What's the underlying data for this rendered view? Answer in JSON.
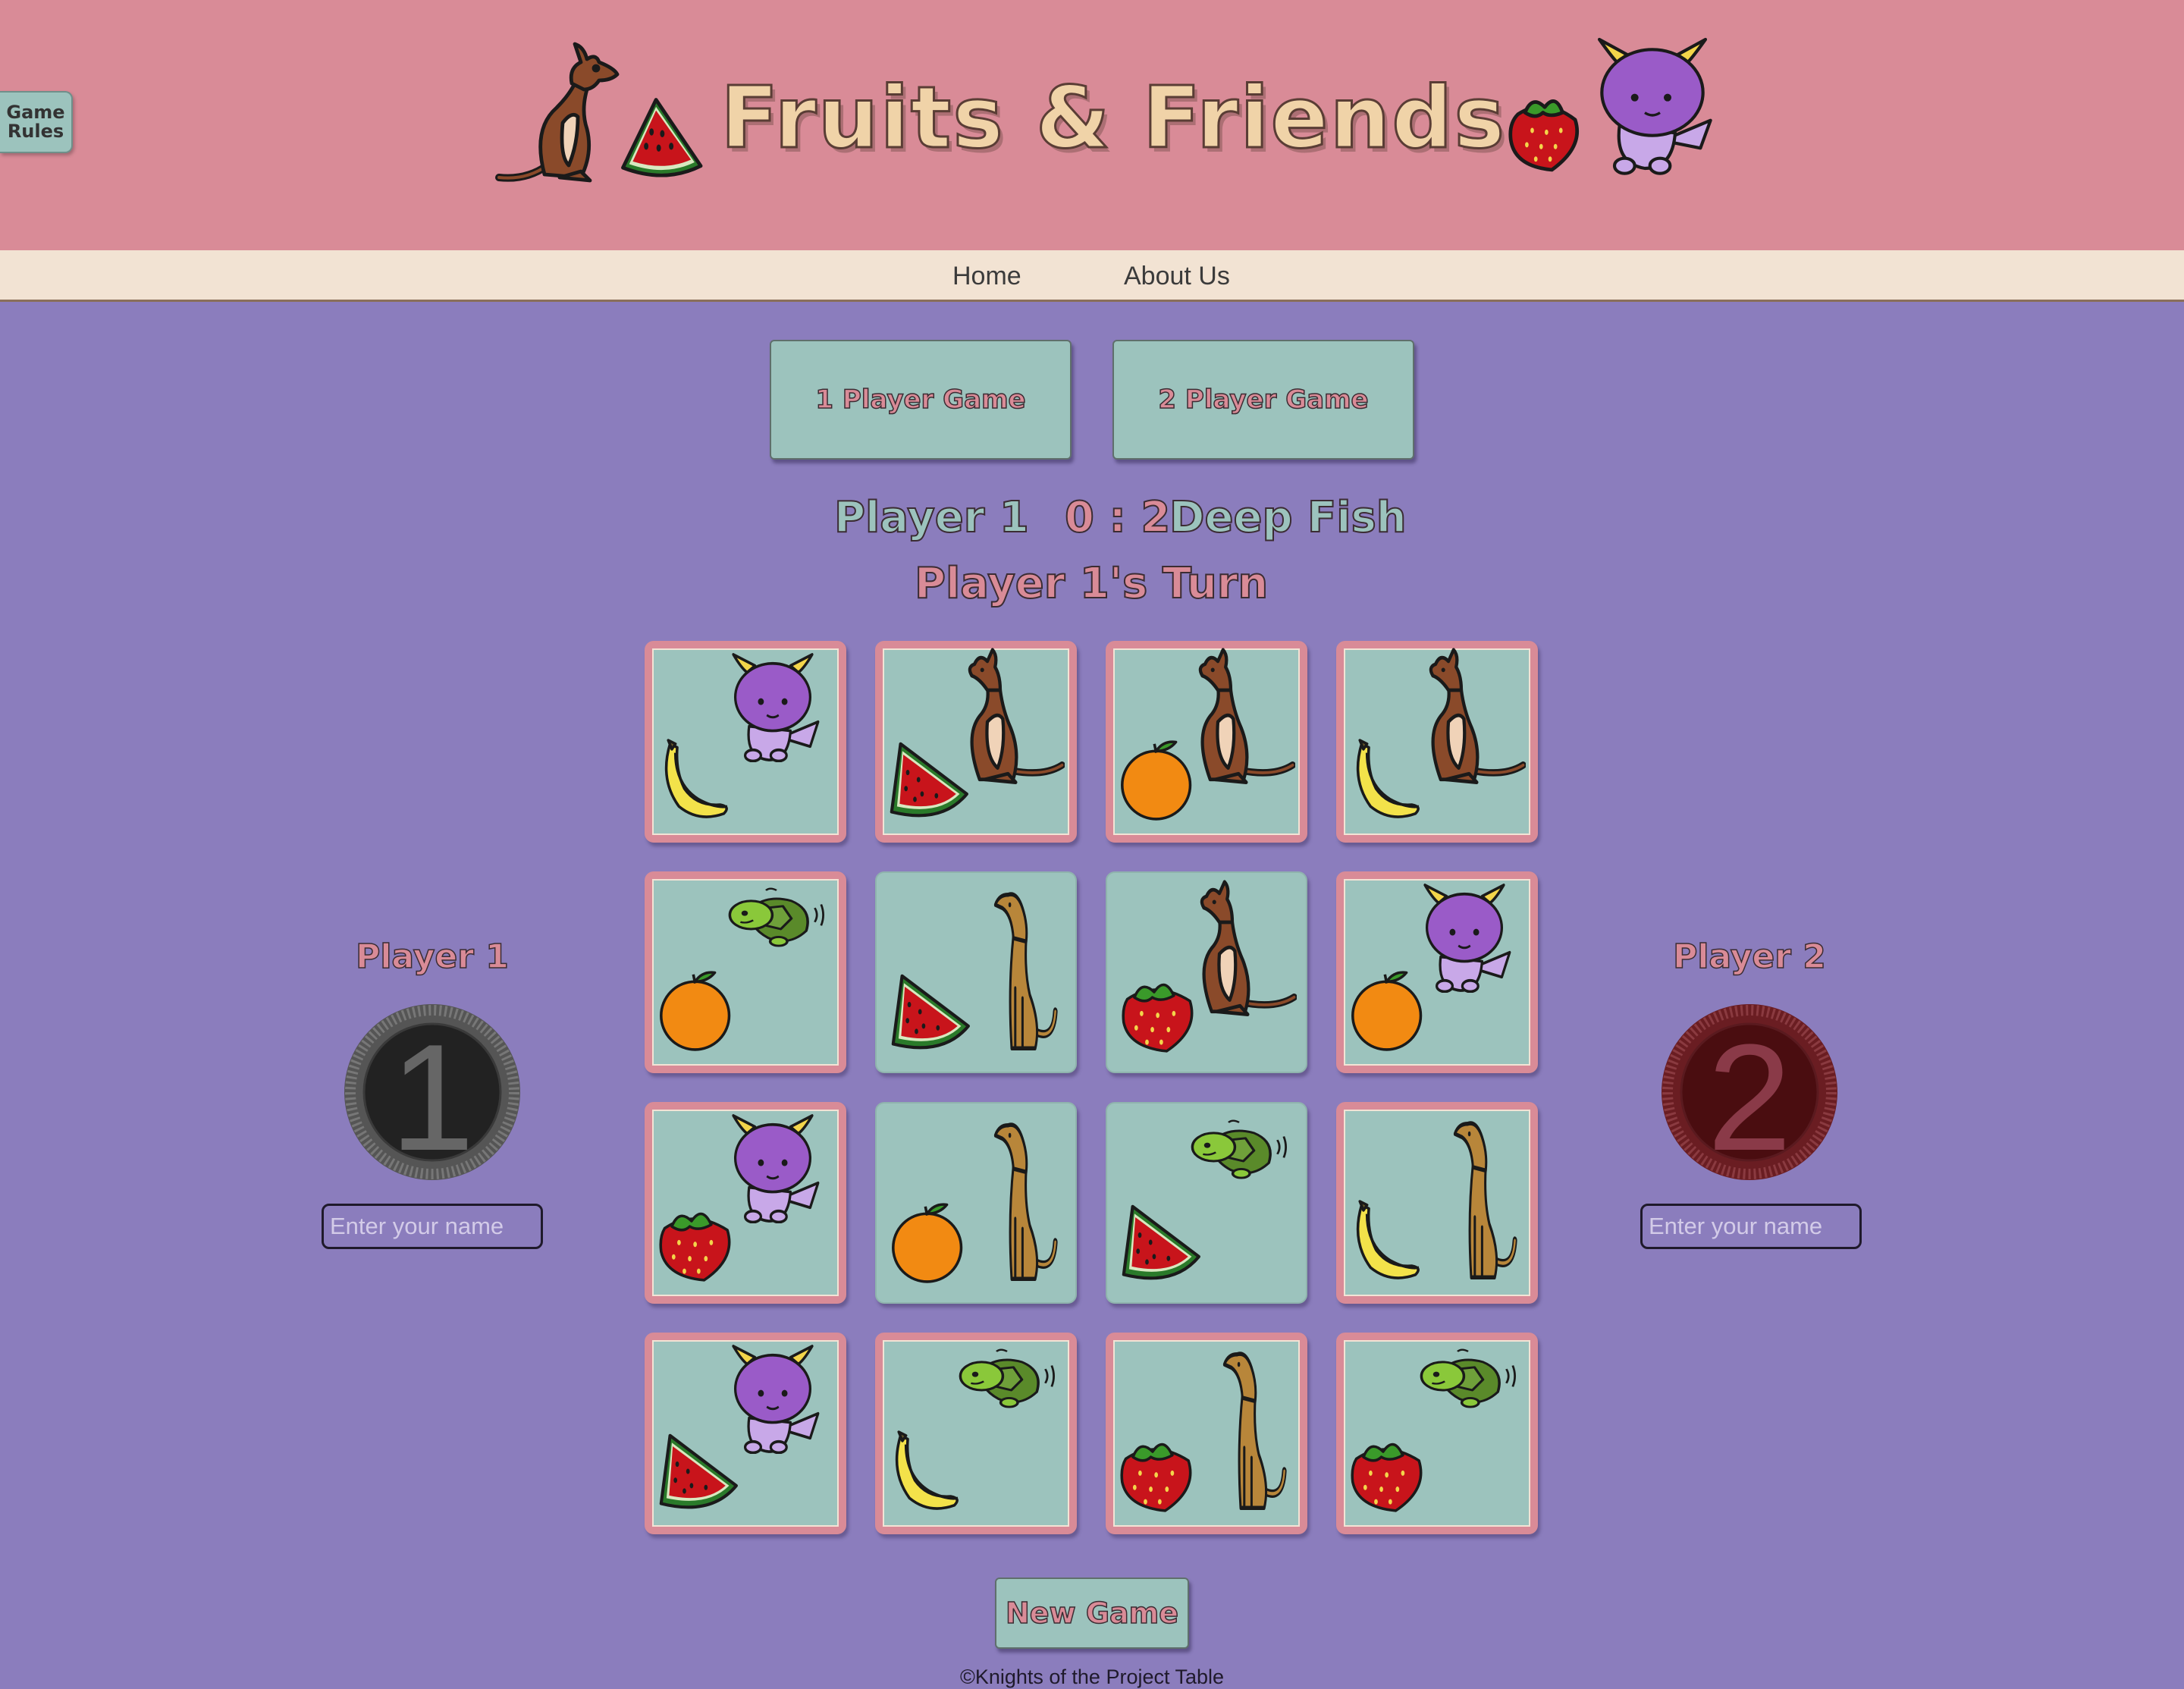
{
  "header": {
    "title": "Fruits & Friends",
    "rules_button": [
      "Game",
      "Rules"
    ]
  },
  "nav": {
    "home": "Home",
    "about": "About Us"
  },
  "modes": {
    "one_player": "1 Player Game",
    "two_player": "2 Player Game"
  },
  "scoreboard": {
    "player1_name": "Player 1",
    "score": "0 : 2",
    "player2_name": "Deep Fish",
    "turn": "Player 1's Turn"
  },
  "players": [
    {
      "label": "Player 1",
      "token": "1",
      "placeholder": "Enter your name",
      "token_color": "#222222"
    },
    {
      "label": "Player 2",
      "token": "2",
      "placeholder": "Enter your name",
      "token_color": "#4a0d10"
    }
  ],
  "board": [
    {
      "animal": "dragon",
      "fruit": "banana",
      "matched": false
    },
    {
      "animal": "kangaroo",
      "fruit": "watermelon",
      "matched": false
    },
    {
      "animal": "kangaroo",
      "fruit": "orange",
      "matched": false
    },
    {
      "animal": "kangaroo",
      "fruit": "banana",
      "matched": false
    },
    {
      "animal": "turtle",
      "fruit": "orange",
      "matched": false
    },
    {
      "animal": "greyhound",
      "fruit": "watermelon",
      "matched": true
    },
    {
      "animal": "kangaroo",
      "fruit": "strawberry",
      "matched": true
    },
    {
      "animal": "dragon",
      "fruit": "orange",
      "matched": false
    },
    {
      "animal": "dragon",
      "fruit": "strawberry",
      "matched": false
    },
    {
      "animal": "greyhound",
      "fruit": "orange",
      "matched": true
    },
    {
      "animal": "turtle",
      "fruit": "watermelon",
      "matched": true
    },
    {
      "animal": "greyhound",
      "fruit": "banana",
      "matched": false
    },
    {
      "animal": "dragon",
      "fruit": "watermelon",
      "matched": false
    },
    {
      "animal": "turtle",
      "fruit": "banana",
      "matched": false
    },
    {
      "animal": "greyhound",
      "fruit": "strawberry",
      "matched": false
    },
    {
      "animal": "turtle",
      "fruit": "strawberry",
      "matched": false
    }
  ],
  "controls": {
    "new_game": "New Game"
  },
  "footer": "©Knights of the Project Table",
  "colors": {
    "background": "#8b7dbd",
    "header": "#d98b97",
    "nav": "#f2e3d3",
    "card": "#9cc3bd",
    "frame": "#d98b97",
    "title": "#f0d3a8"
  }
}
